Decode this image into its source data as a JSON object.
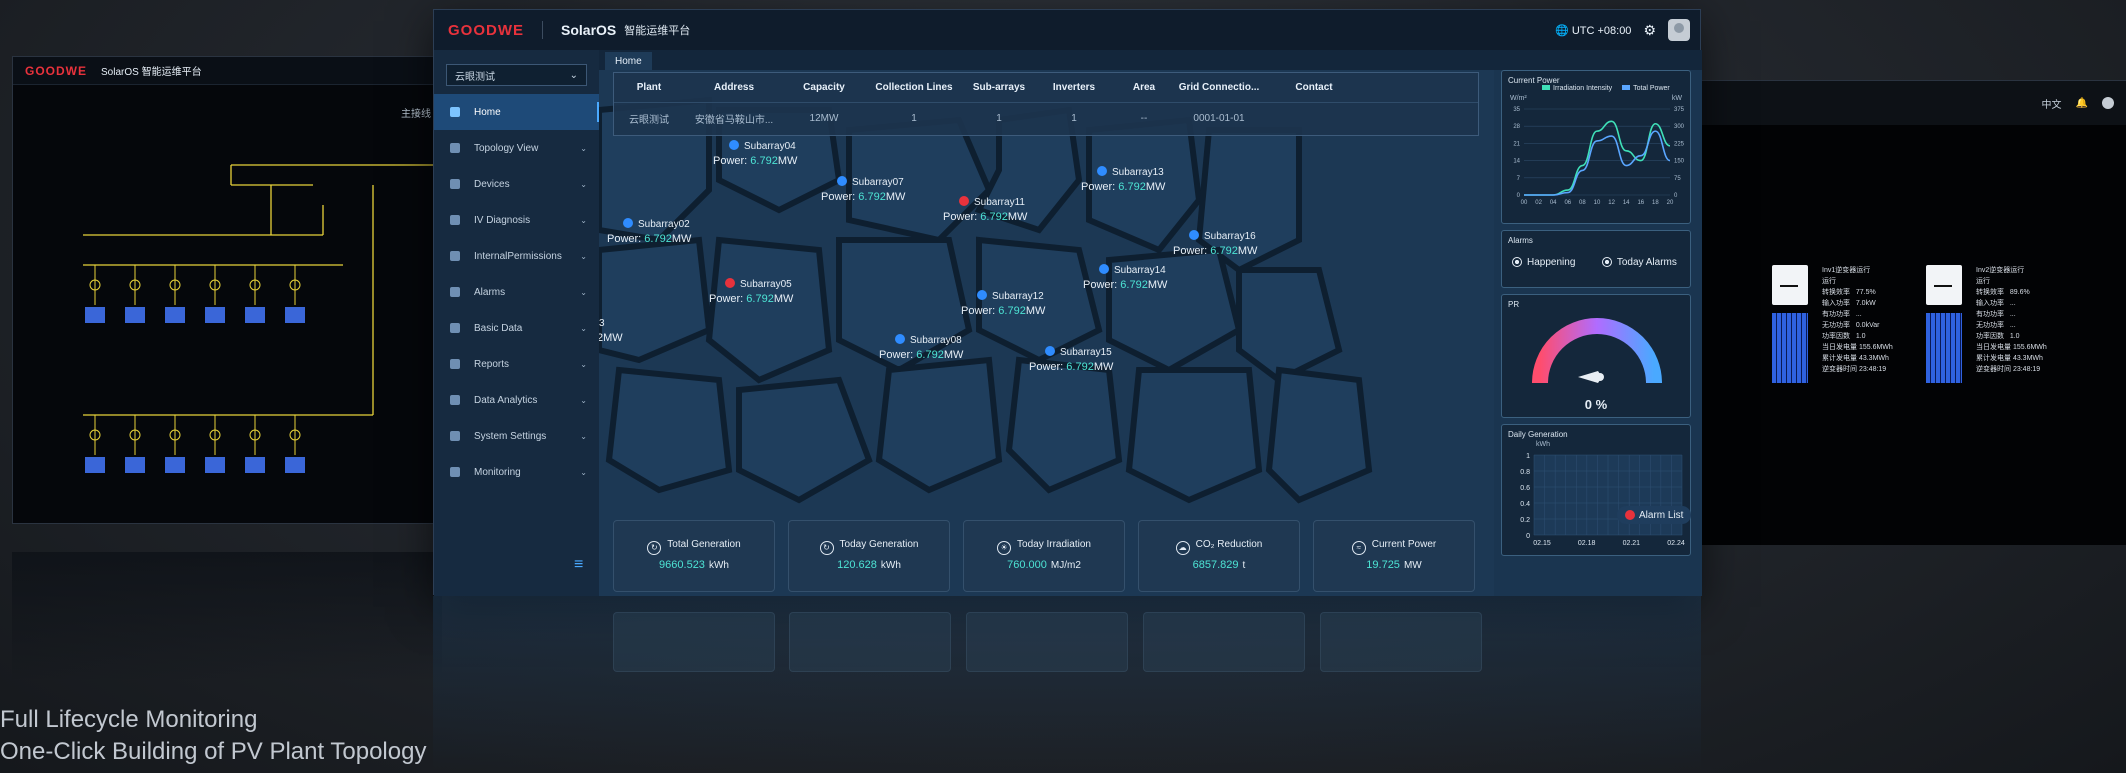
{
  "left_panel": {
    "logo": "GOODWE",
    "title": "SolarOS 智能运维平台",
    "right_text": "主接线"
  },
  "right_panel": {
    "lang": "中文",
    "blocks": [
      {
        "lines": "Inv1逆变器运行\n运行\n转换效率   77.5%\n输入功率   7.0kW\n有功功率   ...\n无功功率   0.0kVar\n功率因数   1.0\n当日发电量 155.6MWh\n累计发电量 43.3MWh\n逆变器时间 23:48:19"
      },
      {
        "lines": "Inv2逆变器运行\n运行\n转换效率   89.6%\n输入功率   ...\n有功功率   ...\n无功功率   ...\n功率因数   1.0\n当日发电量 155.6MWh\n累计发电量 43.3MWh\n逆变器时间 23:48:19"
      }
    ]
  },
  "header": {
    "logo": "GOODWE",
    "brand": "SolarOS",
    "subtitle": "智能运维平台",
    "timezone": "UTC +08:00"
  },
  "sidebar": {
    "plant_select": "云眼测试",
    "items": [
      {
        "label": "Home",
        "active": true
      },
      {
        "label": "Topology View"
      },
      {
        "label": "Devices"
      },
      {
        "label": "IV Diagnosis"
      },
      {
        "label": "InternalPermissions"
      },
      {
        "label": "Alarms"
      },
      {
        "label": "Basic Data"
      },
      {
        "label": "Reports"
      },
      {
        "label": "Data Analytics"
      },
      {
        "label": "System Settings"
      },
      {
        "label": "Monitoring"
      }
    ]
  },
  "tabs": [
    "Home"
  ],
  "table": {
    "headers": [
      "Plant",
      "Address",
      "Capacity",
      "Collection Lines",
      "Sub-arrays",
      "Inverters",
      "Area",
      "Grid Connectio...",
      "Contact"
    ],
    "row": [
      "云眼测试",
      "安徽省马鞍山市...",
      "12MW",
      "1",
      "1",
      "1",
      "--",
      "0001-01-01",
      ""
    ]
  },
  "subarrays": [
    {
      "name": "Subarray04",
      "power": "6.792",
      "unit": "MW",
      "status": "normal"
    },
    {
      "name": "Subarray07",
      "power": "6.792",
      "unit": "MW",
      "status": "normal"
    },
    {
      "name": "Subarray11",
      "power": "6.792",
      "unit": "MW",
      "status": "alarm"
    },
    {
      "name": "Subarray13",
      "power": "6.792",
      "unit": "MW",
      "status": "normal"
    },
    {
      "name": "Subarray02",
      "power": "6.792",
      "unit": "MW",
      "status": "normal"
    },
    {
      "name": "Subarray16",
      "power": "6.792",
      "unit": "MW",
      "status": "normal"
    },
    {
      "name": "Subarray05",
      "power": "6.792",
      "unit": "MW",
      "status": "alarm"
    },
    {
      "name": "Subarray14",
      "power": "6.792",
      "unit": "MW",
      "status": "normal"
    },
    {
      "name": "Subarray12",
      "power": "6.792",
      "unit": "MW",
      "status": "normal"
    },
    {
      "name": "Subarray08",
      "power": "6.792",
      "unit": "MW",
      "status": "normal"
    },
    {
      "name": "Subarray15",
      "power": "6.792",
      "unit": "MW",
      "status": "normal"
    }
  ],
  "partial_label": {
    "name": "3",
    "power": "2MW"
  },
  "stats": [
    {
      "title": "Total Generation",
      "value": "9660.523",
      "unit": "kWh"
    },
    {
      "title": "Today Generation",
      "value": "120.628",
      "unit": "kWh"
    },
    {
      "title": "Today Irradiation",
      "value": "760.000",
      "unit": "MJ/m2"
    },
    {
      "title": "CO₂ Reduction",
      "value": "6857.829",
      "unit": "t"
    },
    {
      "title": "Current Power",
      "value": "19.725",
      "unit": "MW"
    }
  ],
  "widgets": {
    "current_power": {
      "title": "Current Power",
      "legend": [
        "Irradiation Intensity",
        "Total Power"
      ],
      "left_unit": "W/m²",
      "right_unit": "kW"
    },
    "alarms": {
      "title": "Alarms",
      "options": [
        "Happening",
        "Today Alarms"
      ]
    },
    "pr": {
      "title": "PR",
      "value": "0 %",
      "percent": 0
    },
    "daily_generation": {
      "title": "Daily Generation",
      "unit": "kWh"
    },
    "alarm_list": "Alarm List"
  },
  "chart_data": [
    {
      "type": "line",
      "title": "Current Power",
      "x": [
        "00",
        "02",
        "04",
        "06",
        "08",
        "10",
        "12",
        "14",
        "16",
        "18",
        "20"
      ],
      "series": [
        {
          "name": "Irradiation Intensity",
          "values": [
            0,
            0,
            0,
            2,
            12,
            26,
            30,
            18,
            14,
            29,
            20
          ]
        },
        {
          "name": "Total Power",
          "values": [
            0,
            0,
            0,
            1,
            10,
            22,
            24,
            12,
            16,
            26,
            14
          ]
        }
      ],
      "ylim": [
        0,
        35
      ],
      "y_ticks": [
        0,
        7,
        14,
        21,
        28,
        35
      ],
      "y2_ticks": [
        0,
        75,
        150,
        225,
        300,
        375
      ],
      "ylabel": "W/m²",
      "y2label": "kW"
    },
    {
      "type": "bar",
      "title": "Daily Generation",
      "ylabel": "kWh",
      "categories": [
        "02.15",
        "02.18",
        "02.21",
        "02.24"
      ],
      "values": [
        0,
        0,
        0,
        0
      ],
      "ylim": [
        0,
        1
      ],
      "y_ticks": [
        0,
        0.2,
        0.4,
        0.6,
        0.8,
        1
      ]
    }
  ],
  "captions": [
    "Full Lifecycle Monitoring",
    "One-Click Building of PV Plant Topology"
  ]
}
